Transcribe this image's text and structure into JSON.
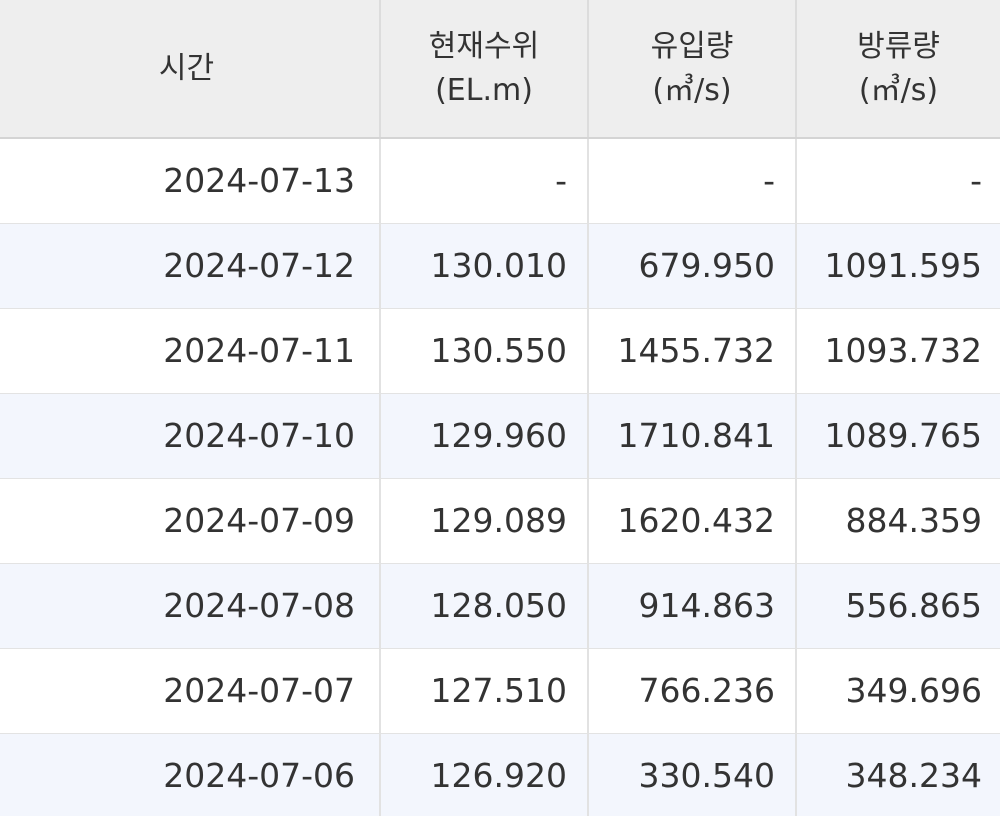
{
  "table": {
    "headers": [
      {
        "line1": "시간",
        "line2": ""
      },
      {
        "line1": "현재수위",
        "line2": "(EL.m)"
      },
      {
        "line1": "유입량",
        "line2": "(㎥/s)"
      },
      {
        "line1": "방류량",
        "line2": "(㎥/s)"
      }
    ],
    "rows": [
      {
        "time": "2024-07-13",
        "level": "-",
        "inflow": "-",
        "outflow": "-"
      },
      {
        "time": "2024-07-12",
        "level": "130.010",
        "inflow": "679.950",
        "outflow": "1091.595"
      },
      {
        "time": "2024-07-11",
        "level": "130.550",
        "inflow": "1455.732",
        "outflow": "1093.732"
      },
      {
        "time": "2024-07-10",
        "level": "129.960",
        "inflow": "1710.841",
        "outflow": "1089.765"
      },
      {
        "time": "2024-07-09",
        "level": "129.089",
        "inflow": "1620.432",
        "outflow": "884.359"
      },
      {
        "time": "2024-07-08",
        "level": "128.050",
        "inflow": "914.863",
        "outflow": "556.865"
      },
      {
        "time": "2024-07-07",
        "level": "127.510",
        "inflow": "766.236",
        "outflow": "349.696"
      },
      {
        "time": "2024-07-06",
        "level": "126.920",
        "inflow": "330.540",
        "outflow": "348.234"
      }
    ]
  }
}
